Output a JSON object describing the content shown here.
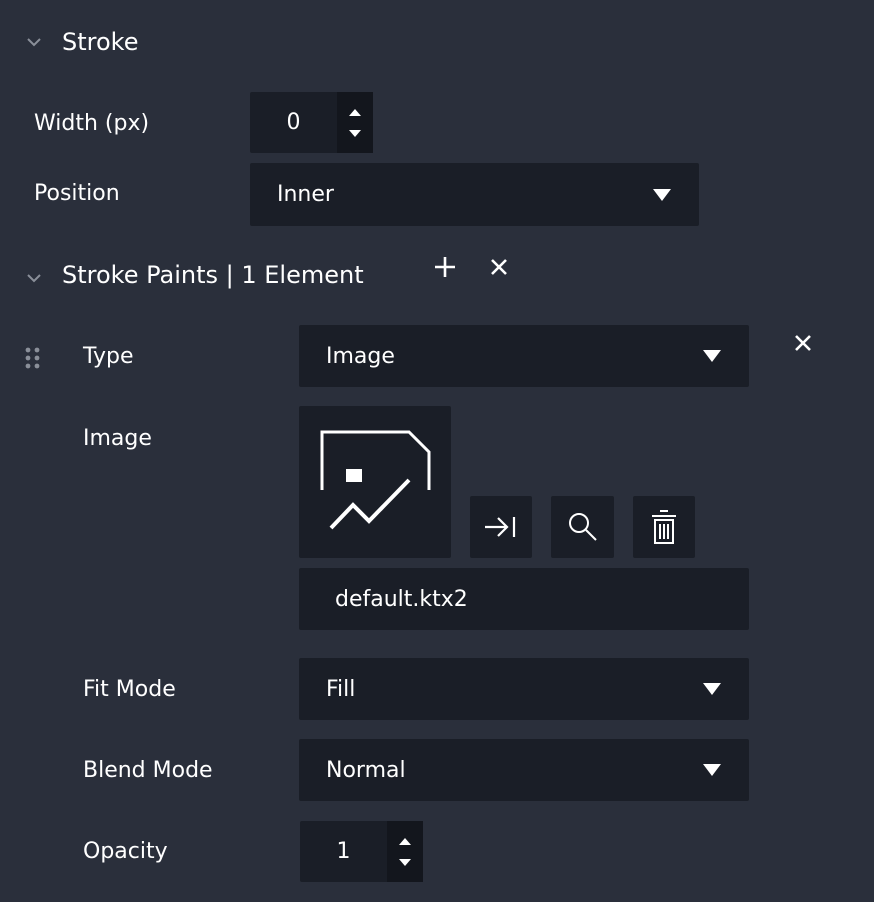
{
  "stroke_section": {
    "title": "Stroke",
    "width_label": "Width (px)",
    "width_value": "0",
    "position_label": "Position",
    "position_value": "Inner"
  },
  "paints_section": {
    "title": "Stroke Paints | 1 Element",
    "add_icon": "plus-icon",
    "clear_icon": "close-icon"
  },
  "paint_item": {
    "type_label": "Type",
    "type_value": "Image",
    "image_label": "Image",
    "image_filename": "default.ktx2",
    "fit_label": "Fit Mode",
    "fit_value": "Fill",
    "blend_label": "Blend Mode",
    "blend_value": "Normal",
    "opacity_label": "Opacity",
    "opacity_value": "1",
    "icons": {
      "drag": "drag-handle-icon",
      "remove": "close-icon",
      "assign": "arrow-to-line-icon",
      "search": "search-icon",
      "delete": "trash-icon",
      "preview": "image-placeholder-icon"
    }
  },
  "colors": {
    "background": "#2a2f3b",
    "field": "#1a1e27",
    "spinner": "#13161d",
    "text": "#ffffff",
    "chevron": "#8a8f99"
  }
}
